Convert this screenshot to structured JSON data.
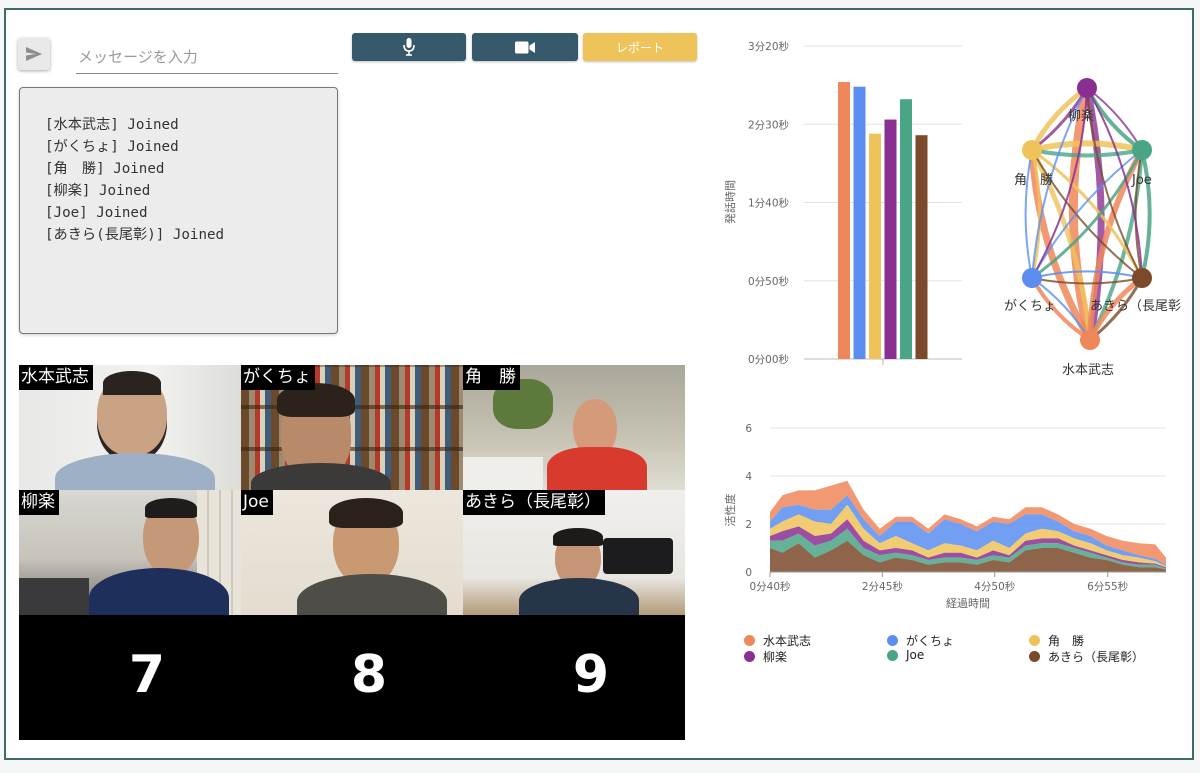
{
  "composer": {
    "placeholder": "メッセージを入力",
    "send_icon": "send-icon"
  },
  "toolbar": {
    "mic_icon": "microphone-icon",
    "camera_icon": "video-camera-icon",
    "report_label": "レポート",
    "accent": "#35586a",
    "report_color": "#eec35a"
  },
  "chat_log": [
    "[水本武志] Joined",
    "[がくちょ] Joined",
    "[角　勝] Joined",
    "[柳楽] Joined",
    "[Joe] Joined",
    "[あきら(長尾彰)] Joined"
  ],
  "video_tiles": [
    {
      "name": "水本武志"
    },
    {
      "name": "がくちょ"
    },
    {
      "name": "角　勝"
    },
    {
      "name": "柳楽"
    },
    {
      "name": "Joe"
    },
    {
      "name": "あきら（長尾彰）"
    }
  ],
  "empty_slots": [
    "7",
    "8",
    "9"
  ],
  "participants": [
    {
      "name": "水本武志",
      "color": "#f0875a"
    },
    {
      "name": "がくちょ",
      "color": "#5b8ef0"
    },
    {
      "name": "角　勝",
      "color": "#eec35a"
    },
    {
      "name": "柳楽",
      "color": "#8a2f92"
    },
    {
      "name": "Joe",
      "color": "#4aa587"
    },
    {
      "name": "あきら（長尾彰）",
      "color": "#7a4a2a"
    }
  ],
  "chart_data": [
    {
      "type": "bar",
      "ylabel": "発話時間",
      "ytick_labels": [
        "0分00秒",
        "0分50秒",
        "1分40秒",
        "2分30秒",
        "3分20秒"
      ],
      "ylim_seconds": [
        0,
        200
      ],
      "series": [
        {
          "name": "水本武志",
          "value_seconds": 177
        },
        {
          "name": "がくちょ",
          "value_seconds": 174
        },
        {
          "name": "角　勝",
          "value_seconds": 144
        },
        {
          "name": "柳楽",
          "value_seconds": 153
        },
        {
          "name": "Joe",
          "value_seconds": 166
        },
        {
          "name": "あきら（長尾彰）",
          "value_seconds": 143
        }
      ]
    },
    {
      "type": "network",
      "nodes": [
        "柳楽",
        "角　勝",
        "Joe",
        "がくちょ",
        "あきら（長尾彰）",
        "水本武志"
      ],
      "node_labels": [
        "柳楽",
        "角　勝",
        "Joe",
        "がくちょ",
        "あきら（長尾彰",
        "水本武志"
      ]
    },
    {
      "type": "area",
      "stacked": true,
      "xlabel": "経過時間",
      "ylabel": "活性度",
      "xtick_labels": [
        "0分40秒",
        "2分45秒",
        "4分50秒",
        "6分55秒"
      ],
      "ytick_labels": [
        "0",
        "2",
        "4",
        "6"
      ],
      "ylim": [
        0,
        6
      ],
      "x_minutes": [
        0.67,
        0.9,
        1.2,
        1.5,
        1.8,
        2.1,
        2.4,
        2.7,
        3.0,
        3.3,
        3.6,
        3.9,
        4.2,
        4.5,
        4.8,
        5.1,
        5.4,
        5.7,
        6.0,
        6.3,
        6.6,
        6.9,
        7.2,
        7.5,
        7.8,
        8.0
      ],
      "series": [
        {
          "name": "あきら（長尾彰）",
          "values": [
            1.0,
            0.8,
            1.2,
            0.6,
            0.9,
            1.3,
            0.7,
            0.4,
            0.6,
            0.5,
            0.3,
            0.4,
            0.4,
            0.3,
            0.5,
            0.4,
            0.9,
            1.0,
            1.0,
            0.8,
            0.6,
            0.5,
            0.3,
            0.2,
            0.2,
            0.1
          ]
        },
        {
          "name": "Joe",
          "values": [
            0.3,
            0.5,
            0.4,
            0.5,
            0.4,
            0.5,
            0.3,
            0.3,
            0.2,
            0.2,
            0.2,
            0.2,
            0.2,
            0.2,
            0.2,
            0.2,
            0.2,
            0.2,
            0.2,
            0.2,
            0.2,
            0.1,
            0.1,
            0.1,
            0.1,
            0.05
          ]
        },
        {
          "name": "柳楽",
          "values": [
            0.2,
            0.4,
            0.3,
            0.4,
            0.3,
            0.4,
            0.3,
            0.2,
            0.2,
            0.2,
            0.1,
            0.2,
            0.2,
            0.1,
            0.2,
            0.1,
            0.2,
            0.2,
            0.2,
            0.1,
            0.1,
            0.1,
            0.1,
            0.1,
            0.05,
            0.05
          ]
        },
        {
          "name": "角　勝",
          "values": [
            0.3,
            0.4,
            0.5,
            0.6,
            0.4,
            0.6,
            0.5,
            0.3,
            0.5,
            0.3,
            0.3,
            0.4,
            0.3,
            0.3,
            0.4,
            0.3,
            0.3,
            0.4,
            0.3,
            0.3,
            0.3,
            0.2,
            0.2,
            0.2,
            0.1,
            0.05
          ]
        },
        {
          "name": "がくちょ",
          "values": [
            0.3,
            0.6,
            0.4,
            0.5,
            0.6,
            0.4,
            0.4,
            0.3,
            0.6,
            0.9,
            0.7,
            1.0,
            0.9,
            0.8,
            0.8,
            1.0,
            0.8,
            0.6,
            0.4,
            0.3,
            0.3,
            0.2,
            0.2,
            0.1,
            0.1,
            0.05
          ]
        },
        {
          "name": "水本武志",
          "values": [
            0.4,
            0.5,
            0.6,
            0.8,
            1.0,
            0.6,
            0.4,
            0.3,
            0.2,
            0.2,
            0.2,
            0.2,
            0.2,
            0.2,
            0.2,
            0.2,
            0.3,
            0.3,
            0.3,
            0.3,
            0.3,
            0.4,
            0.4,
            0.5,
            0.6,
            0.3
          ]
        }
      ]
    }
  ]
}
